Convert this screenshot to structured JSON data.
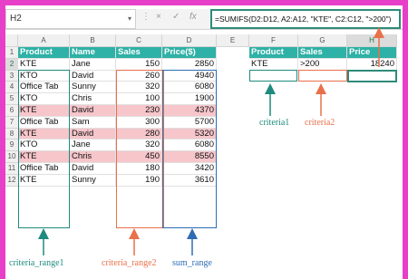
{
  "namebox": {
    "value": "H2"
  },
  "formula_bar": {
    "formula": "=SUMIFS(D2:D12, A2:A12, \"KTE\", C2:C12, \">200\")",
    "cancel": "×",
    "enter": "✓",
    "fx": "fx"
  },
  "columns": [
    "A",
    "B",
    "C",
    "D",
    "E",
    "F",
    "G",
    "H"
  ],
  "rows": [
    "1",
    "2",
    "3",
    "4",
    "5",
    "6",
    "7",
    "8",
    "9",
    "10",
    "11",
    "12"
  ],
  "table": {
    "headers": [
      "Product",
      "Name",
      "Sales",
      "Price($)"
    ],
    "rows": [
      {
        "product": "KTE",
        "name": "Jane",
        "sales": "150",
        "price": "2850",
        "highlight": false
      },
      {
        "product": "KTO",
        "name": "David",
        "sales": "260",
        "price": "4940",
        "highlight": false
      },
      {
        "product": "Office Tab",
        "name": "Sunny",
        "sales": "320",
        "price": "6080",
        "highlight": false
      },
      {
        "product": "KTO",
        "name": "Chris",
        "sales": "100",
        "price": "1900",
        "highlight": false
      },
      {
        "product": "KTE",
        "name": "David",
        "sales": "230",
        "price": "4370",
        "highlight": true
      },
      {
        "product": "Office Tab",
        "name": "Sam",
        "sales": "300",
        "price": "5700",
        "highlight": false
      },
      {
        "product": "KTE",
        "name": "David",
        "sales": "280",
        "price": "5320",
        "highlight": true
      },
      {
        "product": "KTO",
        "name": "Jane",
        "sales": "320",
        "price": "6080",
        "highlight": false
      },
      {
        "product": "KTE",
        "name": "Chris",
        "sales": "450",
        "price": "8550",
        "highlight": true
      },
      {
        "product": "Office Tab",
        "name": "David",
        "sales": "180",
        "price": "3420",
        "highlight": false
      },
      {
        "product": "KTE",
        "name": "Sunny",
        "sales": "190",
        "price": "3610",
        "highlight": false
      }
    ]
  },
  "criteria_table": {
    "headers": [
      "Product",
      "Sales",
      "Price"
    ],
    "values": [
      "KTE",
      ">200",
      "18240"
    ]
  },
  "annotations": {
    "criteria1": "criteria1",
    "criteria2": "criteria2",
    "criteria_range1": "criteria_range1",
    "criteria_range2": "criteria_range2",
    "sum_range": "sum_range"
  },
  "colors": {
    "header": "#2eb1a6",
    "highlight": "#f6c6cb",
    "teal": "#1f8a7e",
    "orange": "#e8704a",
    "blue": "#2e6db4",
    "background": "#e83fc9"
  }
}
